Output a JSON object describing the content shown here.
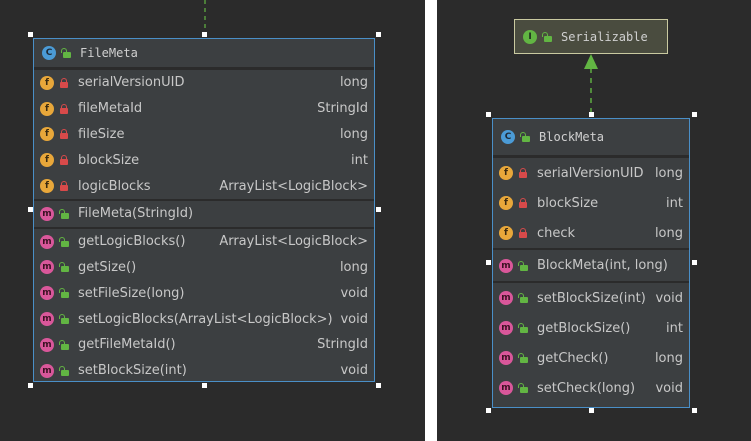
{
  "left_diagram": {
    "class": {
      "kind": "C",
      "name": "FileMeta",
      "fields": [
        {
          "badge": "f",
          "static": true,
          "visibility": "private",
          "name": "serialVersionUID",
          "type": "long"
        },
        {
          "badge": "f",
          "visibility": "private",
          "name": "fileMetaId",
          "type": "StringId"
        },
        {
          "badge": "f",
          "visibility": "private",
          "name": "fileSize",
          "type": "long"
        },
        {
          "badge": "f",
          "visibility": "private",
          "name": "blockSize",
          "type": "int"
        },
        {
          "badge": "f",
          "visibility": "private",
          "name": "logicBlocks",
          "type": "ArrayList<LogicBlock>"
        }
      ],
      "constructors": [
        {
          "badge": "m",
          "visibility": "public",
          "name": "FileMeta(StringId)",
          "type": ""
        }
      ],
      "methods": [
        {
          "badge": "m",
          "visibility": "public",
          "name": "getLogicBlocks()",
          "type": "ArrayList<LogicBlock>"
        },
        {
          "badge": "m",
          "visibility": "public",
          "name": "getSize()",
          "type": "long"
        },
        {
          "badge": "m",
          "visibility": "public",
          "name": "setFileSize(long)",
          "type": "void"
        },
        {
          "badge": "m",
          "visibility": "public",
          "name": "setLogicBlocks(ArrayList<LogicBlock>)",
          "type": "void"
        },
        {
          "badge": "m",
          "visibility": "public",
          "name": "getFileMetaId()",
          "type": "StringId"
        },
        {
          "badge": "m",
          "visibility": "public",
          "name": "setBlockSize(int)",
          "type": "void"
        }
      ]
    }
  },
  "right_diagram": {
    "interface": {
      "kind": "I",
      "name": "Serializable"
    },
    "class": {
      "kind": "C",
      "name": "BlockMeta",
      "fields": [
        {
          "badge": "f",
          "static": true,
          "visibility": "private",
          "name": "serialVersionUID",
          "type": "long"
        },
        {
          "badge": "f",
          "visibility": "private",
          "name": "blockSize",
          "type": "int"
        },
        {
          "badge": "f",
          "visibility": "private",
          "name": "check",
          "type": "long"
        }
      ],
      "constructors": [
        {
          "badge": "m",
          "visibility": "public",
          "name": "BlockMeta(int, long)",
          "type": ""
        }
      ],
      "methods": [
        {
          "badge": "m",
          "visibility": "public",
          "name": "setBlockSize(int)",
          "type": "void"
        },
        {
          "badge": "m",
          "visibility": "public",
          "name": "getBlockSize()",
          "type": "int"
        },
        {
          "badge": "m",
          "visibility": "public",
          "name": "getCheck()",
          "type": "long"
        },
        {
          "badge": "m",
          "visibility": "public",
          "name": "setCheck(long)",
          "type": "void"
        }
      ]
    }
  },
  "colors": {
    "background": "#2b2b2b",
    "class_border": "#4a8fc7",
    "class_fill": "#3c3f41",
    "interface_border": "#c9c9a0",
    "connector": "#62b543"
  }
}
